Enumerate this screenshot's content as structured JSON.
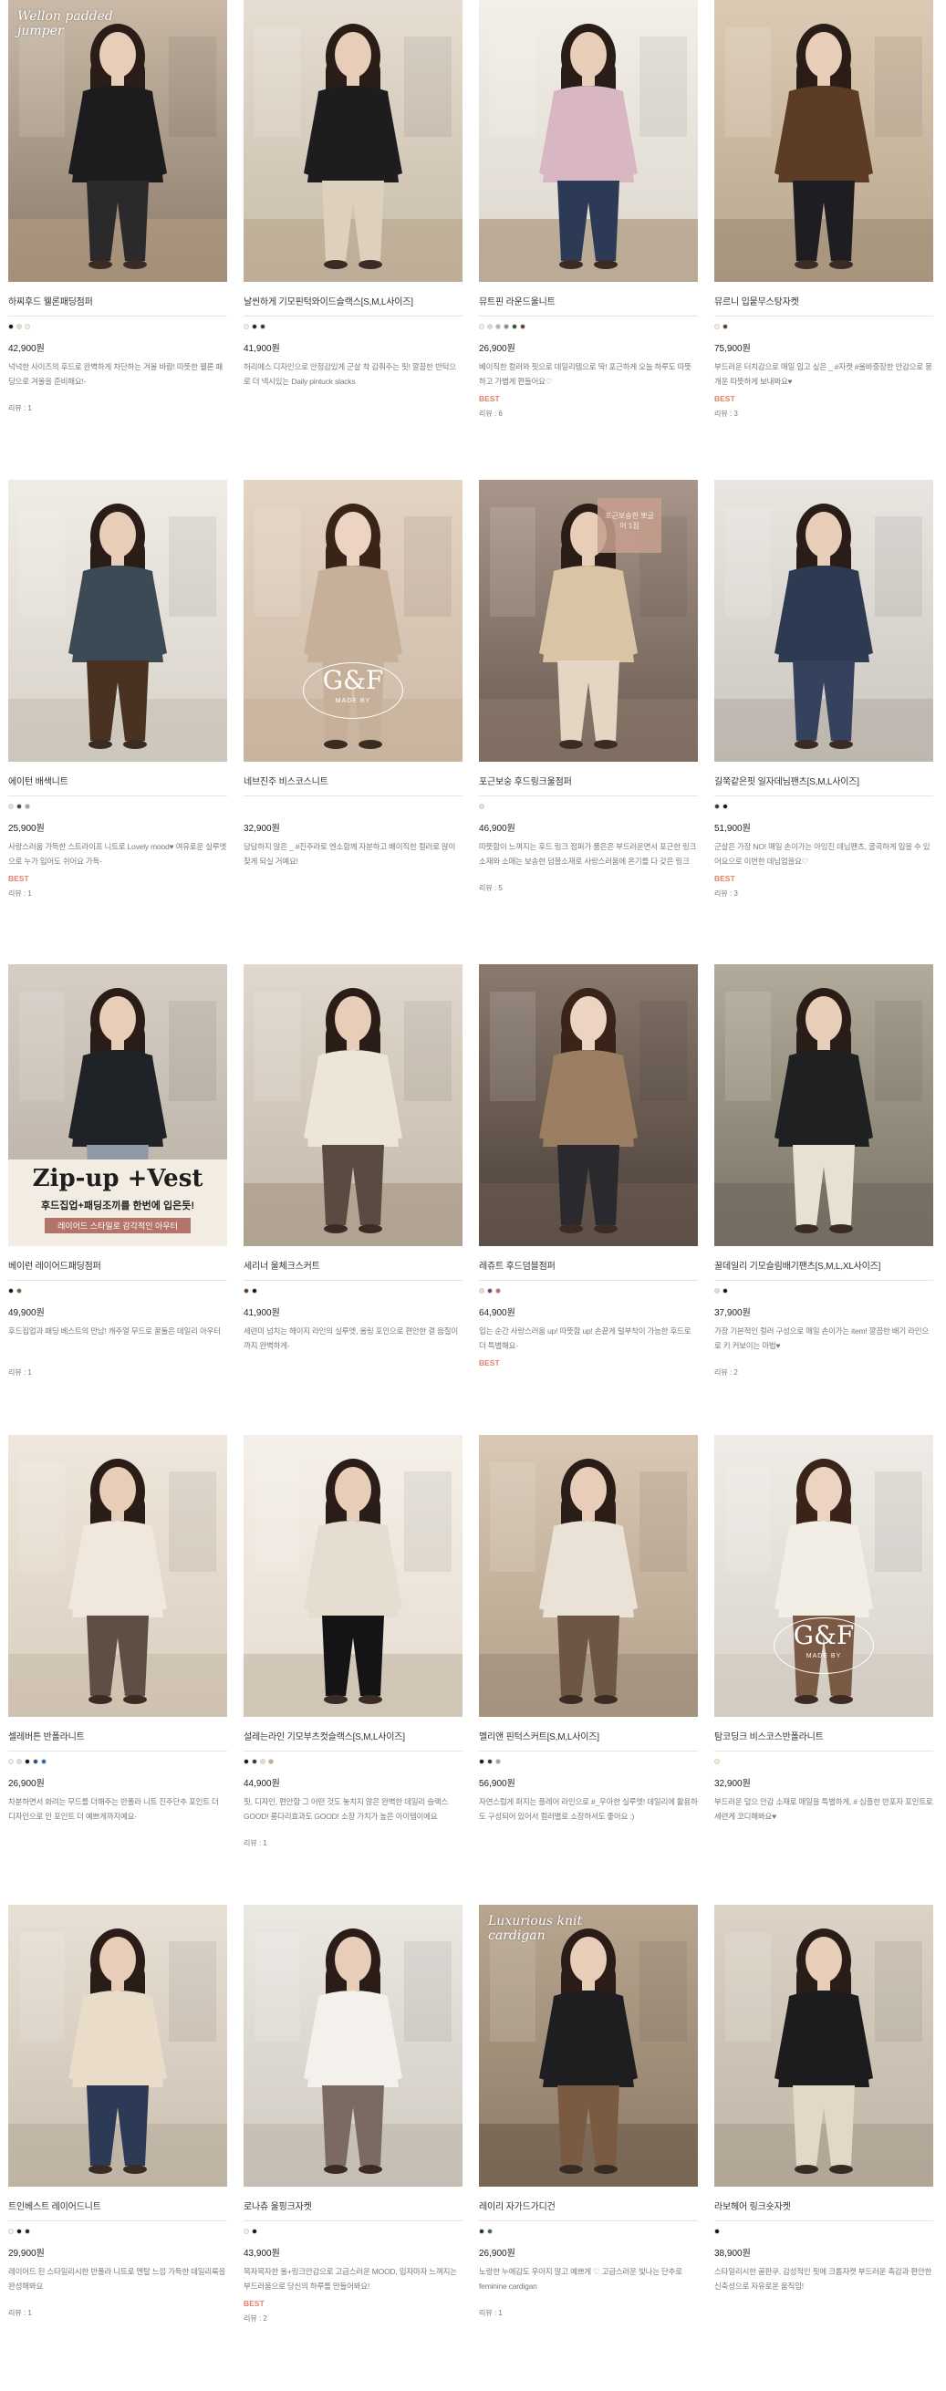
{
  "products": [
    {
      "name": "하찌후드 웰론패딩점퍼",
      "price": "42,900원",
      "colors": [
        "#111111",
        "#e8dcc2",
        "#f5f0e6"
      ],
      "desc": "넉넉한 사이즈의 후드로 완벽하게 차단하는 겨울 바람! 따뜻한 웰론 패딩으로 겨울을 준비해요!-",
      "best": "",
      "review": "리뷰 : 1",
      "overlay_title": "Wellon padded jumper",
      "overlay_badge": "",
      "overlay_big": "",
      "overlay_sub": "",
      "overlay_banner": "",
      "bg": "#8a7a6a",
      "bg2": "#c9b9a6",
      "coat": "#1c1c1e",
      "pants": "#2a2a2d",
      "skin": "#e8cdb8",
      "hair": "#2a1c16",
      "floor": "#b59d80"
    },
    {
      "name": "날씬하게 기모핀턱와이드슬랙스[S,M,L사이즈]",
      "price": "41,900원",
      "colors": [
        "#f5f0e6",
        "#222222",
        "#333333"
      ],
      "desc": "허리에스 디자인으로 안정감있게 군살 착 감춰주는 핏! 깔끔한 반턱으로 더 넥시있는 Daily pintuck slacks",
      "best": "",
      "review": "",
      "overlay_title": "",
      "overlay_badge": "",
      "overlay_big": "",
      "overlay_sub": "",
      "overlay_banner": "",
      "bg": "#c8bba8",
      "bg2": "#e6ded2",
      "coat": "#1d1d1f",
      "pants": "#ddd1bd",
      "skin": "#e8cdb8",
      "hair": "#2a1c16",
      "floor": "#b8a58c"
    },
    {
      "name": "뮤트핀 라운드울니트",
      "price": "26,900원",
      "colors": [
        "#f4eee2",
        "#e9d8c0",
        "#c8a8b8",
        "#8a8a8a",
        "#3a4a2a",
        "#6a3a2a"
      ],
      "desc": "베이직한 컬러와 핏으로 데일리템으로 딱! 포근하게 오늘 하루도 따뜻하고 가볍게 편들어요♡",
      "best": "BEST",
      "review": "리뷰 : 6",
      "overlay_title": "",
      "overlay_badge": "",
      "overlay_big": "",
      "overlay_sub": "",
      "overlay_banner": "",
      "bg": "#dcd6cc",
      "bg2": "#f2efe9",
      "coat": "#d9b7c2",
      "pants": "#2c3a55",
      "skin": "#e8cdb8",
      "hair": "#2a1c16",
      "floor": "#a48c72"
    },
    {
      "name": "뮤르니 입뭍무스탕자켓",
      "price": "75,900원",
      "colors": [
        "#f5f0e6",
        "#5a3a1e"
      ],
      "desc": "부드러운 터치감으로 매일 입고 싶은 _ #자켓 #울바중장한 안감으로 뭉개운 따뜻하게 보내봐요♥",
      "best": "BEST",
      "review": "리뷰 : 3",
      "overlay_title": "",
      "overlay_badge": "",
      "overlay_big": "",
      "overlay_sub": "",
      "overlay_banner": "",
      "bg": "#b9a58e",
      "bg2": "#dccbb4",
      "coat": "#5c3c24",
      "pants": "#1e1e22",
      "skin": "#e8cdb8",
      "hair": "#2a1c16",
      "floor": "#9c8a72"
    },
    {
      "name": "에이턴 배색니트",
      "price": "25,900원",
      "colors": [
        "#e8dcc2",
        "#5a3a1e",
        "#a0a0a0"
      ],
      "desc": "사랑스러움 가득한 스트라이프 니트로 Lovely mood♥ 여유로운 실루엣으로 누가 입어도 쉬어요 가득-",
      "best": "BEST",
      "review": "리뷰 : 1",
      "overlay_title": "",
      "overlay_badge": "",
      "overlay_big": "",
      "overlay_sub": "",
      "overlay_banner": "",
      "bg": "#d8d2c8",
      "bg2": "#efece6",
      "coat": "#3c4a55",
      "pants": "#4a3222",
      "skin": "#e8cdb8",
      "hair": "#2a1c16",
      "floor": "#c7bfb3"
    },
    {
      "name": "네브진주 비스코스니트",
      "price": "32,900원",
      "colors": [],
      "desc": "담담하지 않은 _ #진주라로 엔소함께 자분하고 배이직한 컬러로 많이 찾게 되실 거예요!",
      "best": "",
      "review": "",
      "overlay_title": "",
      "overlay_badge": "",
      "overlay_big": "G&F",
      "overlay_sub": "MADE BY",
      "overlay_banner": "",
      "bg": "#cdb9a6",
      "bg2": "#e4d4c4",
      "coat": "#c7b09a",
      "pants": "#c7b09a",
      "skin": "#edd3c1",
      "hair": "#3a241a",
      "floor": "#c7b09a"
    },
    {
      "name": "포근보숭 후드링크울점퍼",
      "price": "46,900원",
      "colors": [
        "#e8dcc2"
      ],
      "desc": "따뜻함이 느껴지는 후드 링크 점퍼가 품은은 부드러운면서 포근한 링크소재와 소매는 보송한 덤블소재로 사랑스러움에 온기를 다 갖은 링크 후드점퍼",
      "best": "",
      "review": "리뷰 : 5",
      "overlay_title": "",
      "overlay_badge": "포근보송한 뽀글이 1점",
      "overlay_big": "",
      "overlay_sub": "",
      "overlay_banner": "",
      "bg": "#6a5a50",
      "bg2": "#a8968a",
      "coat": "#d9c4a6",
      "pants": "#e4d6c2",
      "skin": "#e8cdb8",
      "hair": "#2a1c16",
      "floor": "#8c7a6c"
    },
    {
      "name": "길쭉같은핏 일자데님팬츠[S,M,L사이즈]",
      "price": "51,900원",
      "colors": [
        "#2a3a55",
        "#111111"
      ],
      "desc": "군살은 가장 NO! 매일 손이가는 아잉진 데님팬츠, 굴곡하게 입을 수 있어요으로 이번한 데님업을요♡",
      "best": "BEST",
      "review": "리뷰 : 3",
      "overlay_title": "",
      "overlay_badge": "",
      "overlay_big": "",
      "overlay_sub": "",
      "overlay_banner": "",
      "bg": "#cbc6be",
      "bg2": "#e9e6e1",
      "coat": "#2e3a52",
      "pants": "#34425d",
      "skin": "#e8cdb8",
      "hair": "#2a1c16",
      "floor": "#b4aea5"
    },
    {
      "name": "베이런 레이어드패딩점퍼",
      "price": "49,900원",
      "colors": [
        "#111111",
        "#5a6a3a"
      ],
      "desc": "후드집업과 패딩 베스트의 만남! 캐주얼 무드로 꿀둘은 데일리 아우터",
      "best": "",
      "review": "리뷰 : 1",
      "overlay_title": "",
      "overlay_badge": "",
      "overlay_big": "Zip-up +Vest",
      "overlay_sub": "후드집업+패딩조끼를 한번에 입은듯!",
      "overlay_banner": "레이어드 스타일로 감각적인 아우터",
      "bg": "#b7ada2",
      "bg2": "#d6cec5",
      "coat": "#1f2226",
      "pants": "#8e9aa8",
      "skin": "#e8cdb8",
      "hair": "#2a1c16",
      "floor": "#e9e2d8"
    },
    {
      "name": "세리너 울체크스커트",
      "price": "41,900원",
      "colors": [
        "#5a3a1e",
        "#111111"
      ],
      "desc": "세련미 넘치는 헤이지 라인의 실루엣, 울링 포인으로 편안한 결 음질이까지 완벽하게-",
      "best": "",
      "review": "",
      "overlay_title": "",
      "overlay_badge": "",
      "overlay_big": "",
      "overlay_sub": "",
      "overlay_banner": "",
      "bg": "#c4b8aa",
      "bg2": "#e0d8cd",
      "coat": "#ece5d8",
      "pants": "#5b4a42",
      "skin": "#e8cdb8",
      "hair": "#2a1c16",
      "floor": "#a49482"
    },
    {
      "name": "레쥬트 후드덤블점퍼",
      "price": "64,900원",
      "colors": [
        "#e8dcc2",
        "#7a3a7a",
        "#c85a8a"
      ],
      "desc": "입는 순간 사랑스러움 up! 따뜻함 up! 손끝게 털부착이 가능한 후드로 더 특별해요-",
      "best": "BEST",
      "review": "",
      "overlay_title": "",
      "overlay_badge": "",
      "overlay_big": "",
      "overlay_sub": "",
      "overlay_banner": "",
      "bg": "#4a3e38",
      "bg2": "#8a7a6e",
      "coat": "#9c7e62",
      "pants": "#2a2a2e",
      "skin": "#edd3c1",
      "hair": "#3a241a",
      "floor": "#6c5c52"
    },
    {
      "name": "꿀데일리 기모슬림배기팬츠[S,M,L,XL사이즈]",
      "price": "37,900원",
      "colors": [
        "#e8dcc2",
        "#111111"
      ],
      "desc": "가장 기본적인 컬러 구성으로 매일 손이가는 item! 깔끔한 배기 라인으로 키 커보이는 마법♥",
      "best": "",
      "review": "리뷰 : 2",
      "overlay_title": "",
      "overlay_badge": "",
      "overlay_big": "",
      "overlay_sub": "",
      "overlay_banner": "",
      "bg": "#7a7466",
      "bg2": "#b2aa9a",
      "coat": "#1e2022",
      "pants": "#e8e0d0",
      "skin": "#e8cdb8",
      "hair": "#2a1c16",
      "floor": "#6e685e"
    },
    {
      "name": "셀레버튼 반폴라니트",
      "price": "26,900원",
      "colors": [
        "#f5f0e6",
        "#e8dcc2",
        "#111111",
        "#2a4a7a",
        "#1a6abf"
      ],
      "desc": "차분하면서 화려는 무드를 더해주는 반폴라 니트 진주단추 포인트 더 디자인으로 인 포인트 더 예쁘게까지예요-",
      "best": "",
      "review": "",
      "overlay_title": "",
      "overlay_badge": "",
      "overlay_big": "",
      "overlay_sub": "",
      "overlay_banner": "",
      "bg": "#d9cdbd",
      "bg2": "#efe7dc",
      "coat": "#f0e8dc",
      "pants": "#5e4e44",
      "skin": "#e8cdb8",
      "hair": "#2a1c16",
      "floor": "#c8baa8"
    },
    {
      "name": "설레는라인 기모부츠컷슬랙스[S,M,L사이즈]",
      "price": "44,900원",
      "colors": [
        "#111111",
        "#333333",
        "#e8dcc2",
        "#c8a888"
      ],
      "desc": "핏, 디자인, 편안함 그 어떤 것도 놓치지 않은 완벽한 데일리 슬랙스 GOOD! 롱다리효과도 GOOD! 소장 가치가 높은 아이템이에요",
      "best": "",
      "review": "리뷰 : 1",
      "overlay_title": "",
      "overlay_badge": "",
      "overlay_big": "",
      "overlay_sub": "",
      "overlay_banner": "",
      "bg": "#e6ddd1",
      "bg2": "#f4efe8",
      "coat": "#e6ddd1",
      "pants": "#141416",
      "skin": "#e8cdb8",
      "hair": "#2a1c16",
      "floor": "#c3b5a4"
    },
    {
      "name": "멜리앤 핀턱스커트[S,M,L사이즈]",
      "price": "56,900원",
      "colors": [
        "#111111",
        "#333333",
        "#a0a0a0"
      ],
      "desc": "자연스럽게 퍼지는 플레어 라인으로 #_우아한 실루엣! 데일리에 활용하도 구성되어 있어서 컬러별로 소장하셔도 좋아요 :)",
      "best": "",
      "review": "",
      "overlay_title": "",
      "overlay_badge": "",
      "overlay_big": "",
      "overlay_sub": "",
      "overlay_banner": "",
      "bg": "#b4a08a",
      "bg2": "#d8c8b4",
      "coat": "#eae2d6",
      "pants": "#6e5646",
      "skin": "#e8cdb8",
      "hair": "#2a1c16",
      "floor": "#9a8a78"
    },
    {
      "name": "탐코딩크 비스코스반폴라니트",
      "price": "32,900원",
      "colors": [
        "#f5f0c8"
      ],
      "desc": "부드러운 덮으 안감 소재로 매일을 특별하게, # 심플한 반포자 포인트로 세련게 코디해봐요♥",
      "best": "",
      "review": "",
      "overlay_title": "",
      "overlay_badge": "",
      "overlay_big": "G&F",
      "overlay_sub": "MADE BY",
      "overlay_banner": "",
      "bg": "#d8d2ca",
      "bg2": "#efece7",
      "coat": "#f2ede5",
      "pants": "#7a5a44",
      "skin": "#edd3c1",
      "hair": "#3a241a",
      "floor": "#cfc8be"
    },
    {
      "name": "트인베스트 레이어드니트",
      "price": "29,900원",
      "colors": [
        "#f5f0e6",
        "#111111",
        "#222222"
      ],
      "desc": "레이어드 된 스타일리시한 반폴라 니트로 멘탈 느낌 가득한 데일리룩을 완성해봐요",
      "best": "",
      "review": "리뷰 : 1",
      "overlay_title": "",
      "overlay_badge": "",
      "overlay_big": "",
      "overlay_sub": "",
      "overlay_banner": "",
      "bg": "#cbbfb0",
      "bg2": "#e8e0d5",
      "coat": "#e9dcc8",
      "pants": "#2c3a55",
      "skin": "#e8cdb8",
      "hair": "#2a1c16",
      "floor": "#b8ab9b"
    },
    {
      "name": "로나츄 울핑크자켓",
      "price": "43,900원",
      "colors": [
        "#f5f0e6",
        "#111111"
      ],
      "desc": "목자목자한 울+링크안감으로 고급스러운 MOOD, 입자마자 느껴지는 부드러움으로 당신의 하루를 만들어봐요!",
      "best": "BEST",
      "review": "리뷰 : 2",
      "overlay_title": "",
      "overlay_badge": "",
      "overlay_big": "",
      "overlay_sub": "",
      "overlay_banner": "",
      "bg": "#cfc9c0",
      "bg2": "#ebe8e3",
      "coat": "#f4f1ec",
      "pants": "#7a6a62",
      "skin": "#e8cdb8",
      "hair": "#2a1c16",
      "floor": "#bdb6ac"
    },
    {
      "name": "레이리 자가드가디건",
      "price": "26,900원",
      "colors": [
        "#2a2a2a",
        "#3a6a3a"
      ],
      "desc": "노랑한 누에감도 우아지 않고 예쁘게 ♡ 고급스러운 빛나는 단추로 feminine cardigan",
      "best": "",
      "review": "리뷰 : 1",
      "overlay_title": "Luxurious knit cardigan",
      "overlay_badge": "",
      "overlay_big": "",
      "overlay_sub": "",
      "overlay_banner": "",
      "bg": "#8c7a66",
      "bg2": "#b8a690",
      "coat": "#1e1e20",
      "pants": "#7a5a40",
      "skin": "#e8cdb8",
      "hair": "#2a1c16",
      "floor": "#6a5a4a"
    },
    {
      "name": "라보헤어 링크숏자켓",
      "price": "38,900원",
      "colors": [
        "#111111"
      ],
      "desc": "스타일리시한 골판쿠, 감성적인 핏에 크롭자켓 부드러운 촉감과 편안한 신축성으로 자유로운 움직임!",
      "best": "",
      "review": "",
      "overlay_title": "",
      "overlay_badge": "",
      "overlay_big": "",
      "overlay_sub": "",
      "overlay_banner": "",
      "bg": "#bfb5a6",
      "bg2": "#dcd3c6",
      "coat": "#1c1c1e",
      "pants": "#e2d8c6",
      "skin": "#e8cdb8",
      "hair": "#2a1c16",
      "floor": "#a89b8a"
    }
  ]
}
